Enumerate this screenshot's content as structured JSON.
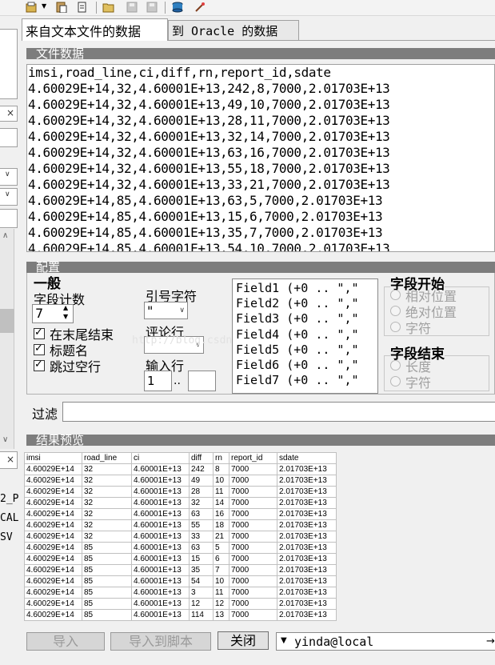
{
  "tabs": {
    "text_file": "来自文本文件的数据",
    "to_oracle": "到 Oracle 的数据"
  },
  "file_data": {
    "header": "文件数据",
    "lines": [
      "imsi,road_line,ci,diff,rn,report_id,sdate",
      "4.60029E+14,32,4.60001E+13,242,8,7000,2.01703E+13",
      "4.60029E+14,32,4.60001E+13,49,10,7000,2.01703E+13",
      "4.60029E+14,32,4.60001E+13,28,11,7000,2.01703E+13",
      "4.60029E+14,32,4.60001E+13,32,14,7000,2.01703E+13",
      "4.60029E+14,32,4.60001E+13,63,16,7000,2.01703E+13",
      "4.60029E+14,32,4.60001E+13,55,18,7000,2.01703E+13",
      "4.60029E+14,32,4.60001E+13,33,21,7000,2.01703E+13",
      "4.60029E+14,85,4.60001E+13,63,5,7000,2.01703E+13",
      "4.60029E+14,85,4.60001E+13,15,6,7000,2.01703E+13",
      "4.60029E+14,85,4.60001E+13,35,7,7000,2.01703E+13",
      "4.60029E+14,85,4.60001E+13,54,10,7000,2.01703E+13"
    ]
  },
  "config": {
    "header": "配置",
    "general": "一般",
    "field_count_label": "字段计数",
    "field_count_value": "7",
    "checkbox_trailing": "在末尾结束",
    "checkbox_header": "标题名",
    "checkbox_skip": "跳过空行",
    "quote_label": "引号字符",
    "quote_value": "\"",
    "comment_label": "评论行",
    "input_label": "输入行",
    "input_from": "1",
    "input_sep": "..",
    "fields": [
      "Field1  (+0 .. \",\"",
      "Field2  (+0 .. \",\"",
      "Field3  (+0 .. \",\"",
      "Field4  (+0 .. \",\"",
      "Field5  (+0 .. \",\"",
      "Field6  (+0 .. \",\"",
      "Field7  (+0 .. \",\""
    ],
    "field_start": {
      "title": "字段开始",
      "options": [
        "相对位置",
        "绝对位置",
        "字符"
      ]
    },
    "field_end": {
      "title": "字段结束",
      "options": [
        "长度",
        "字符"
      ]
    },
    "filter_label": "过滤",
    "watermark": "http://blog.csdn.net/zhengmin..."
  },
  "preview": {
    "header": "结果预览",
    "columns": [
      "imsi",
      "road_line",
      "ci",
      "diff",
      "rn",
      "report_id",
      "sdate"
    ],
    "rows": [
      [
        "4.60029E+14",
        "32",
        "4.60001E+13",
        "242",
        "8",
        "7000",
        "2.01703E+13"
      ],
      [
        "4.60029E+14",
        "32",
        "4.60001E+13",
        "49",
        "10",
        "7000",
        "2.01703E+13"
      ],
      [
        "4.60029E+14",
        "32",
        "4.60001E+13",
        "28",
        "11",
        "7000",
        "2.01703E+13"
      ],
      [
        "4.60029E+14",
        "32",
        "4.60001E+13",
        "32",
        "14",
        "7000",
        "2.01703E+13"
      ],
      [
        "4.60029E+14",
        "32",
        "4.60001E+13",
        "63",
        "16",
        "7000",
        "2.01703E+13"
      ],
      [
        "4.60029E+14",
        "32",
        "4.60001E+13",
        "55",
        "18",
        "7000",
        "2.01703E+13"
      ],
      [
        "4.60029E+14",
        "32",
        "4.60001E+13",
        "33",
        "21",
        "7000",
        "2.01703E+13"
      ],
      [
        "4.60029E+14",
        "85",
        "4.60001E+13",
        "63",
        "5",
        "7000",
        "2.01703E+13"
      ],
      [
        "4.60029E+14",
        "85",
        "4.60001E+13",
        "15",
        "6",
        "7000",
        "2.01703E+13"
      ],
      [
        "4.60029E+14",
        "85",
        "4.60001E+13",
        "35",
        "7",
        "7000",
        "2.01703E+13"
      ],
      [
        "4.60029E+14",
        "85",
        "4.60001E+13",
        "54",
        "10",
        "7000",
        "2.01703E+13"
      ],
      [
        "4.60029E+14",
        "85",
        "4.60001E+13",
        "3",
        "11",
        "7000",
        "2.01703E+13"
      ],
      [
        "4.60029E+14",
        "85",
        "4.60001E+13",
        "12",
        "12",
        "7000",
        "2.01703E+13"
      ],
      [
        "4.60029E+14",
        "85",
        "4.60001E+13",
        "114",
        "13",
        "7000",
        "2.01703E+13"
      ]
    ]
  },
  "buttons": {
    "import": "导入",
    "import_script": "导入到脚本",
    "close": "关闭",
    "connection": "yinda@local"
  },
  "left_strip": {
    "x1": "×",
    "x2": "×",
    "x3": "×",
    "frag1": "2_P",
    "frag2": "CAL",
    "frag3": "SV"
  }
}
